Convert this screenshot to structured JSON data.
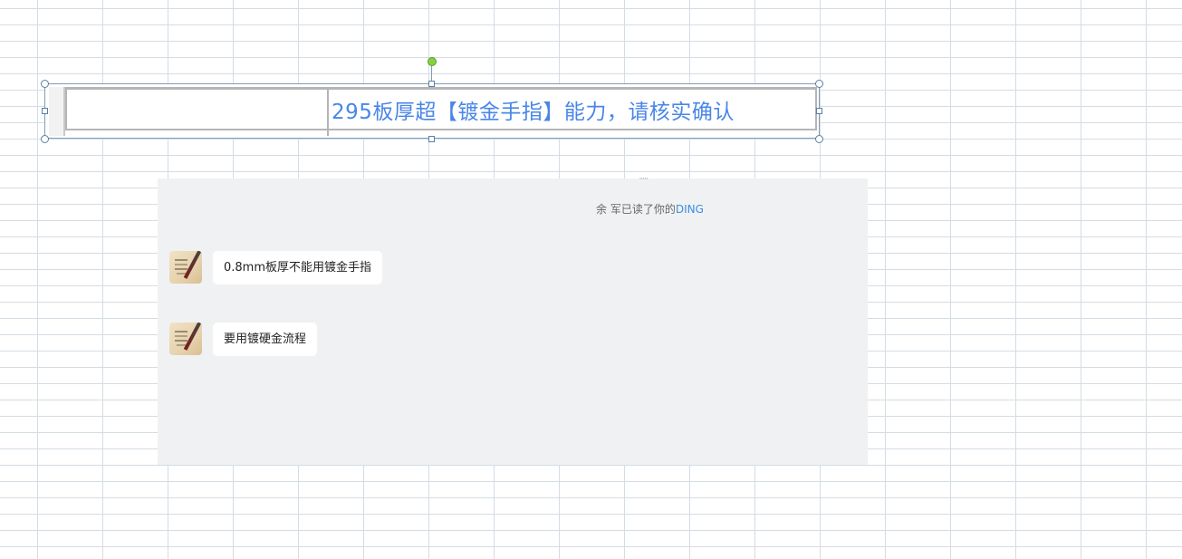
{
  "embedded_object": {
    "text": "295板厚超【镀金手指】能力，请核实确认"
  },
  "chat": {
    "status_prefix": "余 军已读了你的",
    "status_highlight": "DING",
    "messages": [
      {
        "text": "0.8mm板厚不能用镀金手指"
      },
      {
        "text": "要用镀硬金流程"
      }
    ]
  },
  "colors": {
    "object_text": "#4a86e8",
    "ding_link": "#3c8ee0",
    "chat_background": "#f0f1f3"
  }
}
